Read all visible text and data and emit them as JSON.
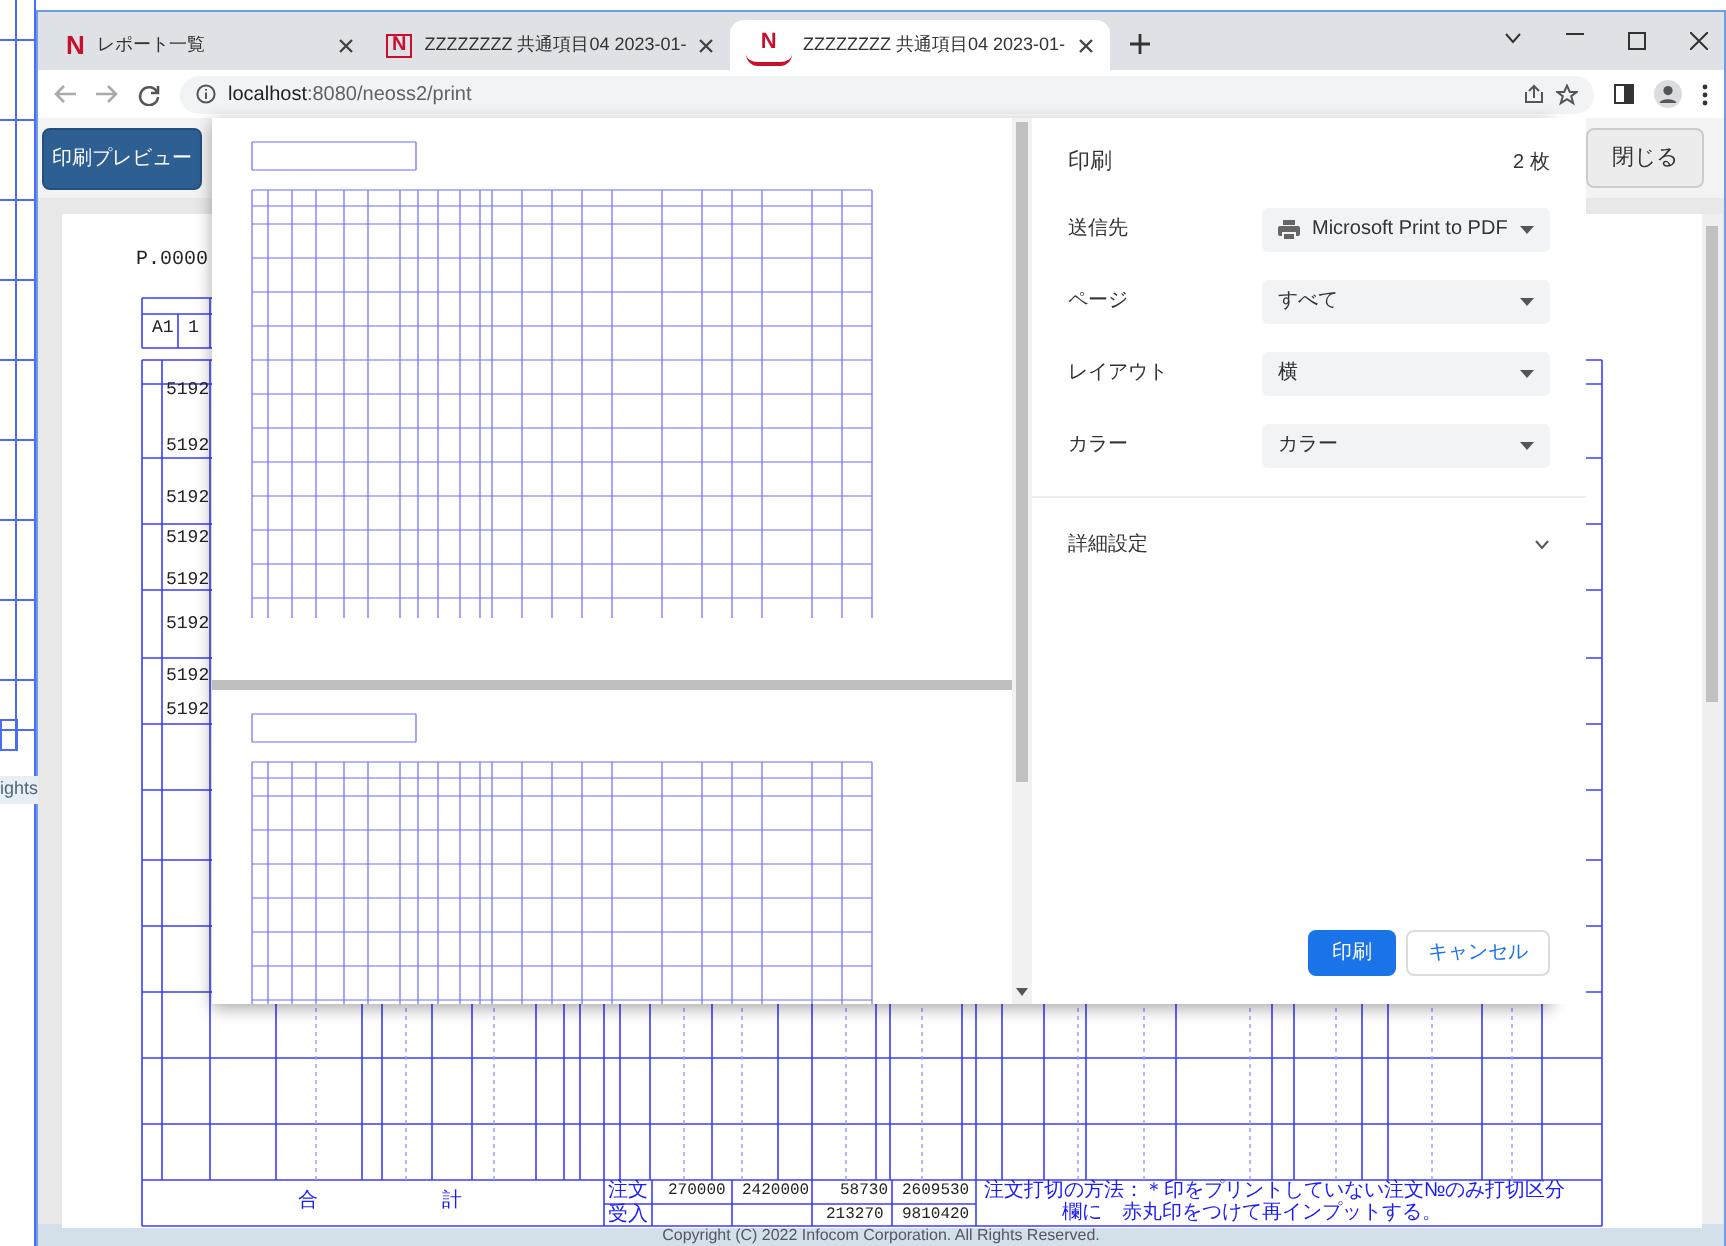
{
  "background_window": {
    "text": "ights"
  },
  "browser": {
    "tabs": [
      {
        "logo": "N",
        "kind": "letter",
        "title": "レポート一覧",
        "selected": false
      },
      {
        "logo": "N",
        "kind": "boxed",
        "title": "ZZZZZZZZ 共通項目04 2023-01-",
        "selected": false
      },
      {
        "logo": "N",
        "kind": "badge",
        "title": "ZZZZZZZZ 共通項目04 2023-01-",
        "selected": true
      }
    ],
    "address": {
      "host": "localhost",
      "path": ":8080/neoss2/print"
    }
  },
  "app": {
    "buttons": [
      {
        "label": "印刷プレビュー",
        "kind": "primary"
      },
      {
        "label": "閉じる",
        "kind": "secondary"
      }
    ],
    "report": {
      "page_no": "P.0000",
      "location": [
        "A1",
        "1"
      ],
      "rows": [
        "5192",
        "5192",
        "5192",
        "5192",
        "5192",
        "5192",
        "5192",
        "5192"
      ],
      "totals": {
        "label": [
          "合",
          "計"
        ],
        "row_labels": [
          "注文",
          "受入"
        ],
        "order": [
          "270000",
          "2420000",
          "58730",
          "2609530"
        ],
        "received": [
          "213270",
          "9810420"
        ]
      },
      "note": [
        "注文打切の方法：＊印をプリントしていない注文№のみ打切区分",
        "欄に　赤丸印をつけて再インプットする。"
      ]
    },
    "footer": "Copyright (C) 2022 Infocom Corporation. All Rights Reserved."
  },
  "print_dialog": {
    "title": "印刷",
    "sheets": "2 枚",
    "preview_pages": [
      {
        "kind": "full"
      },
      {
        "kind": "partial"
      }
    ],
    "settings": [
      {
        "label": "送信先",
        "value": "Microsoft Print to PDF",
        "kind": "printer"
      },
      {
        "label": "ページ",
        "value": "すべて",
        "kind": "select"
      },
      {
        "label": "レイアウト",
        "value": "横",
        "kind": "select"
      },
      {
        "label": "カラー",
        "value": "カラー",
        "kind": "select"
      }
    ],
    "more": {
      "label": "詳細設定",
      "expanded": false
    },
    "buttons": [
      {
        "label": "印刷",
        "kind": "primary"
      },
      {
        "label": "キャンセル",
        "kind": "secondary"
      }
    ]
  }
}
